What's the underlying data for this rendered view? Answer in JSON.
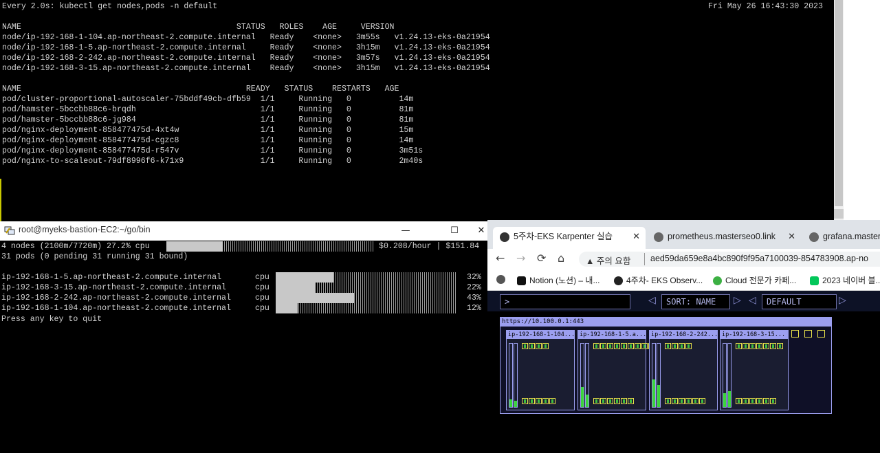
{
  "top_terminal": {
    "lines": [
      {
        "text": "Every 2.0s: kubectl get nodes,pods -n default",
        "right": "Fri May 26 16:43:30 2023"
      },
      {
        "text": ""
      },
      {
        "text": "NAME                                             STATUS   ROLES    AGE     VERSION"
      },
      {
        "text": "node/ip-192-168-1-104.ap-northeast-2.compute.internal   Ready    <none>   3m55s   v1.24.13-eks-0a21954"
      },
      {
        "text": "node/ip-192-168-1-5.ap-northeast-2.compute.internal     Ready    <none>   3h15m   v1.24.13-eks-0a21954"
      },
      {
        "text": "node/ip-192-168-2-242.ap-northeast-2.compute.internal   Ready    <none>   3m57s   v1.24.13-eks-0a21954"
      },
      {
        "text": "node/ip-192-168-3-15.ap-northeast-2.compute.internal    Ready    <none>   3h15m   v1.24.13-eks-0a21954"
      },
      {
        "text": ""
      },
      {
        "text": "NAME                                               READY   STATUS    RESTARTS   AGE"
      },
      {
        "text": "pod/cluster-proportional-autoscaler-75bddf49cb-dfb59  1/1     Running   0          14m"
      },
      {
        "text": "pod/hamster-5bccbb88c6-brqdh                          1/1     Running   0          81m"
      },
      {
        "text": "pod/hamster-5bccbb88c6-jg984                          1/1     Running   0          81m"
      },
      {
        "text": "pod/nginx-deployment-858477475d-4xt4w                 1/1     Running   0          15m"
      },
      {
        "text": "pod/nginx-deployment-858477475d-cgzc8                 1/1     Running   0          14m"
      },
      {
        "text": "pod/nginx-deployment-858477475d-r547v                 1/1     Running   0          3m51s"
      },
      {
        "text": "pod/nginx-to-scaleout-79df8996f6-k71x9                1/1     Running   0          2m40s"
      }
    ]
  },
  "bottom_terminal": {
    "window_title": "root@myeks-bastion-EC2:~/go/bin",
    "minimize": "—",
    "maximize": "☐",
    "close": "✕",
    "summary_1_left": "4 nodes (2100m/7720m) 27.2% cpu",
    "summary_1_right": "$0.208/hour | $151.84",
    "summary_1_pct": 27.2,
    "summary_2": "31 pods (0 pending 31 running 31 bound)",
    "nodes": [
      {
        "name": "ip-192-168-1-5.ap-northeast-2.compute.internal",
        "metric": "cpu",
        "pct": 32,
        "pct_label": "32%"
      },
      {
        "name": "ip-192-168-3-15.ap-northeast-2.compute.internal",
        "metric": "cpu",
        "pct": 22,
        "pct_label": "22%"
      },
      {
        "name": "ip-192-168-2-242.ap-northeast-2.compute.internal",
        "metric": "cpu",
        "pct": 43,
        "pct_label": "43%"
      },
      {
        "name": "ip-192-168-1-104.ap-northeast-2.compute.internal",
        "metric": "cpu",
        "pct": 12,
        "pct_label": "12%"
      }
    ],
    "quit_hint": "Press any key to quit"
  },
  "browser": {
    "tabs": [
      {
        "label": "5주차-EKS  Karpenter 실습",
        "close": "✕"
      },
      {
        "label": "prometheus.masterseo0.link",
        "close": "✕"
      },
      {
        "label": "grafana.masters",
        "close": "✕"
      }
    ],
    "nav": {
      "back": "←",
      "forward": "→",
      "reload": "⟳",
      "home": "⌂"
    },
    "url_warning": "▲ 주의 요함",
    "url": "aed59da659e8a4bc890f9f95a7100039-854783908.ap-no",
    "bookmarks": [
      {
        "label": "Notion (노션) – 내...",
        "color": "#111111"
      },
      {
        "label": "4주차- EKS Observ...",
        "color": "#222222"
      },
      {
        "label": "Cloud 전문가 카페...",
        "color": "#3cb043"
      },
      {
        "label": "2023 네이버 블...",
        "color": "#03c75a"
      }
    ]
  },
  "kube_ops_view": {
    "search_prompt": ">",
    "sort_label": "SORT: NAME",
    "namespace_label": "DEFAULT",
    "left_arrow": "◁",
    "right_arrow": "▷",
    "cluster_url": "https://10.100.0.1:443",
    "nodes": [
      {
        "label": "ip-192-168-1-104...",
        "cpu": 0.12,
        "mem": 0.1,
        "top_pods": 4,
        "bottom_pods": 5
      },
      {
        "label": "ip-192-168-1-5.a...",
        "cpu": 0.32,
        "mem": 0.2,
        "top_pods": 9,
        "bottom_pods": 6
      },
      {
        "label": "ip-192-168-2-242...",
        "cpu": 0.43,
        "mem": 0.35,
        "top_pods": 4,
        "bottom_pods": 6
      },
      {
        "label": "ip-192-168-3-15...",
        "cpu": 0.22,
        "mem": 0.25,
        "top_pods": 7,
        "bottom_pods": 6
      }
    ],
    "unscheduled_pods": 3
  }
}
